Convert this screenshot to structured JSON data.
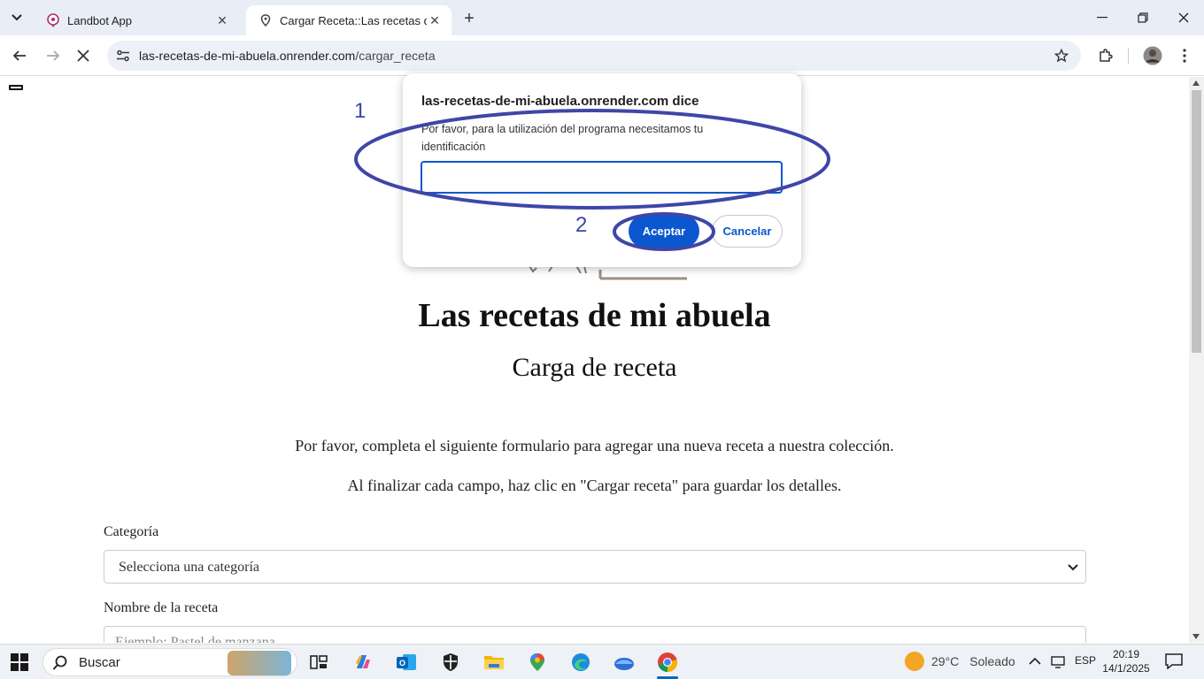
{
  "browser": {
    "tabs": [
      {
        "title": "Landbot App",
        "active": false
      },
      {
        "title": "Cargar Receta::Las recetas de m",
        "active": true
      }
    ],
    "address_domain": "las-recetas-de-mi-abuela.onrender.com",
    "address_path": "/cargar_receta"
  },
  "page": {
    "title": "Las recetas de mi abuela",
    "subtitle": "Carga de receta",
    "intro_1": "Por favor, completa el siguiente formulario para agregar una nueva receta a nuestra colección.",
    "intro_2": "Al finalizar cada campo, haz clic en \"Cargar receta\" para guardar los detalles.",
    "category_label": "Categoría",
    "category_value": "Selecciona una categoría",
    "recipe_name_label": "Nombre de la receta",
    "recipe_name_placeholder": "Ejemplo: Pastel de manzana"
  },
  "dialog": {
    "title": "las-recetas-de-mi-abuela.onrender.com dice",
    "message": "Por favor, para la utilización del programa necesitamos tu identificación",
    "input_value": "",
    "ok_label": "Aceptar",
    "cancel_label": "Cancelar"
  },
  "annotations": {
    "label_1": "1",
    "label_2": "2",
    "color": "#3f46a8"
  },
  "taskbar": {
    "search_label": "Buscar",
    "weather_temp": "29°C",
    "weather_desc": "Soleado",
    "language": "ESP",
    "time": "20:19",
    "date": "14/1/2025"
  },
  "colors": {
    "accent": "#0b57d0",
    "tabstrip": "#e9eef6"
  }
}
